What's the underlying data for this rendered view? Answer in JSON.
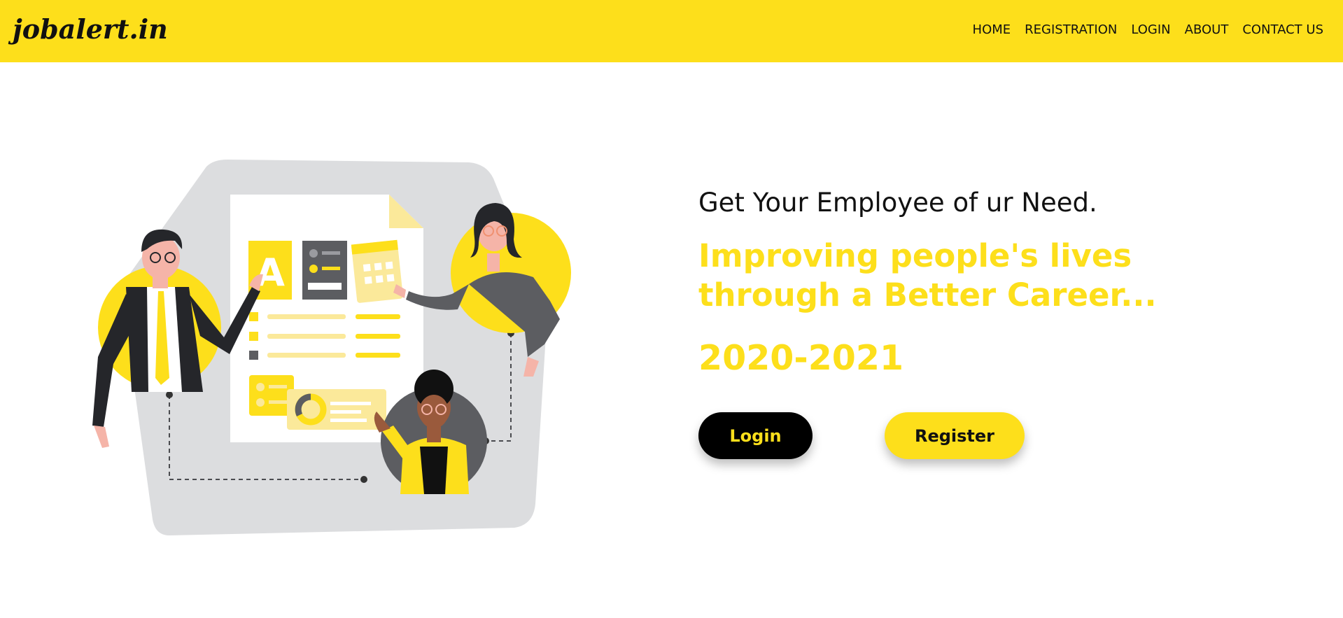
{
  "brand": {
    "name": "jobalert.in"
  },
  "nav": {
    "items": [
      "HOME",
      "REGISTRATION",
      "LOGIN",
      "ABOUT",
      "CONTACT US"
    ]
  },
  "hero": {
    "subheading": "Get Your Employee of ur Need.",
    "headline": "Improving people's lives through a Better Career...",
    "years": "2020-2021",
    "login_label": "Login",
    "register_label": "Register"
  },
  "colors": {
    "accent": "#fddf1b",
    "dark": "#000000",
    "text": "#111111",
    "illustration_bg": "#dcdddf",
    "slate": "#5c5d61"
  },
  "illustration": {
    "icons": [
      "document-icon",
      "calendar-icon",
      "person-icon",
      "chart-icon"
    ],
    "doc_badge": "A"
  }
}
